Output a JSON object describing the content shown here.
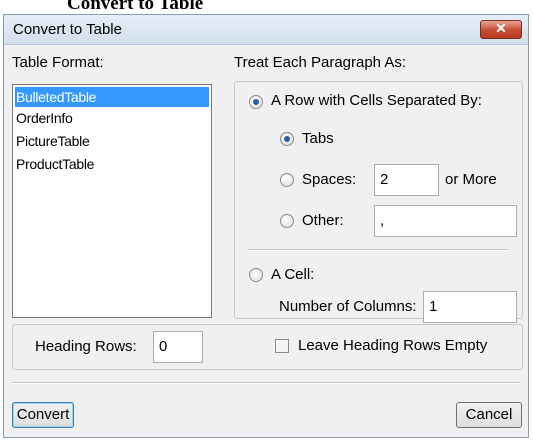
{
  "background": {
    "heading_text": "Convert to Table"
  },
  "dialog": {
    "title": "Convert to Table",
    "close_icon": "close-icon",
    "close_glyph": "✕"
  },
  "table_format": {
    "label": "Table Format:",
    "items": [
      "BulletedTable",
      "OrderInfo",
      "PictureTable",
      "ProductTable"
    ],
    "selected": "BulletedTable"
  },
  "paragraph": {
    "label": "Treat Each Paragraph As:",
    "row_option": {
      "label": "A Row with Cells Separated By:",
      "checked": true
    },
    "tabs": {
      "label": "Tabs",
      "checked": true
    },
    "spaces": {
      "label": "Spaces:",
      "value": "2",
      "suffix": "or More",
      "checked": false
    },
    "other": {
      "label": "Other:",
      "value": ",",
      "checked": false
    },
    "cell_option": {
      "label": "A Cell:",
      "checked": false
    },
    "columns": {
      "label": "Number of Columns:",
      "value": "1"
    }
  },
  "heading": {
    "rows_label": "Heading Rows:",
    "rows_value": "0",
    "leave_empty_label": "Leave Heading Rows Empty",
    "leave_empty_checked": false
  },
  "buttons": {
    "convert": "Convert",
    "cancel": "Cancel"
  }
}
